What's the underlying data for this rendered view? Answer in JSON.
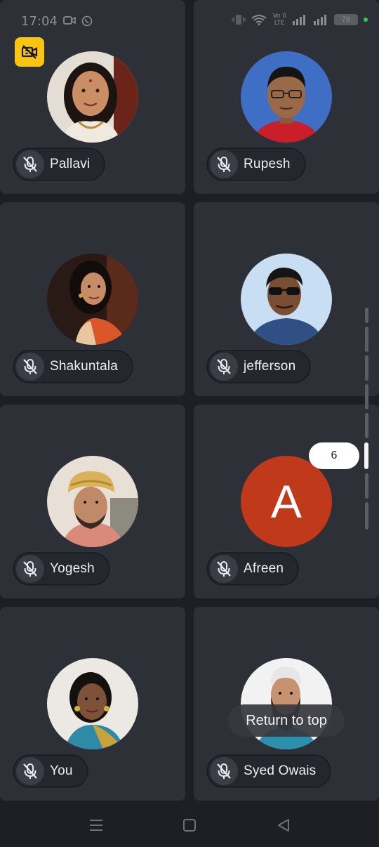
{
  "status_bar": {
    "time": "17:04",
    "volte_line1": "Vo 0",
    "volte_line2": "LTE",
    "battery": "76"
  },
  "tiles": [
    {
      "name": "Pallavi",
      "avatar": "photo",
      "mic": "muted"
    },
    {
      "name": "Rupesh",
      "avatar": "photo",
      "mic": "muted"
    },
    {
      "name": "Shakuntala",
      "avatar": "photo",
      "mic": "muted"
    },
    {
      "name": "jefferson",
      "avatar": "photo",
      "mic": "muted"
    },
    {
      "name": "Yogesh",
      "avatar": "photo",
      "mic": "muted"
    },
    {
      "name": "Afreen",
      "avatar": "letter",
      "letter": "A",
      "avatar_color": "#c0391b",
      "mic": "muted"
    },
    {
      "name": "You",
      "avatar": "photo",
      "mic": "muted"
    },
    {
      "name": "Syed Owais",
      "avatar": "photo",
      "mic": "muted"
    }
  ],
  "scroll": {
    "page_label": "6"
  },
  "return_to_top": "Return to top",
  "colors": {
    "background": "#1e1f24",
    "tile": "#2e3038",
    "camera_off_badge": "#f9c512",
    "letter_avatar": "#c0391b"
  },
  "icons": {
    "camera_off": "camera-off-icon",
    "mic_muted": "mic-off-icon",
    "nav_recents": "recents-icon",
    "nav_home": "home-icon",
    "nav_back": "back-icon"
  }
}
